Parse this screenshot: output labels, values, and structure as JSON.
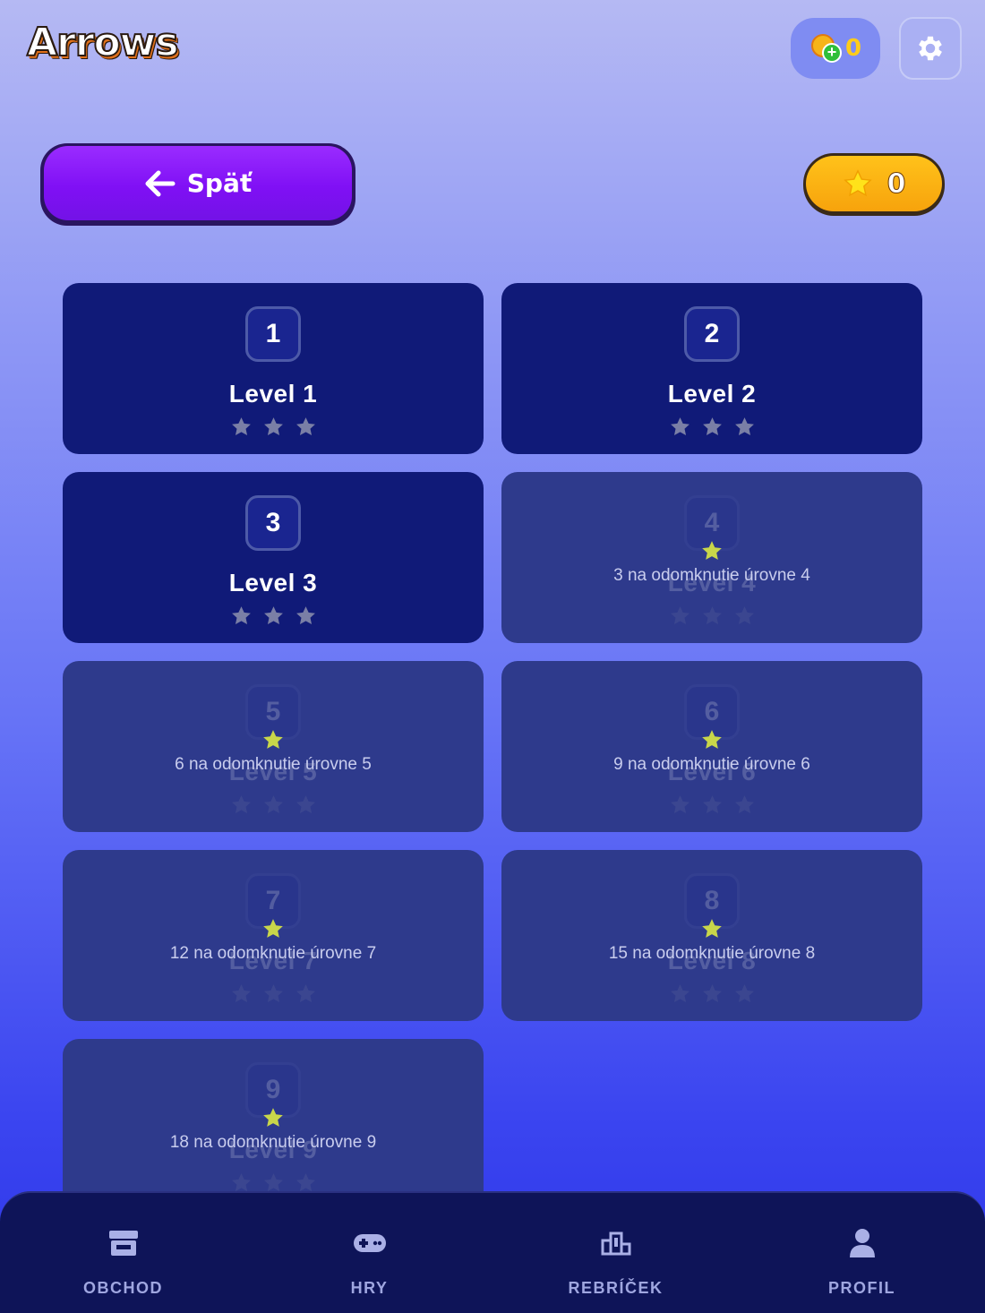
{
  "header": {
    "app_title": "Arrows",
    "coins": "0",
    "settings_icon": "gear-icon"
  },
  "toolbar": {
    "back_label": "Späť",
    "stars_total": "0"
  },
  "levels": [
    {
      "number": "1",
      "name": "Level 1",
      "stars": 0,
      "locked": false,
      "lock_text": ""
    },
    {
      "number": "2",
      "name": "Level 2",
      "stars": 0,
      "locked": false,
      "lock_text": ""
    },
    {
      "number": "3",
      "name": "Level 3",
      "stars": 0,
      "locked": false,
      "lock_text": ""
    },
    {
      "number": "4",
      "name": "Level 4",
      "stars": 0,
      "locked": true,
      "lock_text": "3 na odomknutie úrovne 4"
    },
    {
      "number": "5",
      "name": "Level 5",
      "stars": 0,
      "locked": true,
      "lock_text": "6 na odomknutie úrovne 5"
    },
    {
      "number": "6",
      "name": "Level 6",
      "stars": 0,
      "locked": true,
      "lock_text": "9 na odomknutie úrovne 6"
    },
    {
      "number": "7",
      "name": "Level 7",
      "stars": 0,
      "locked": true,
      "lock_text": "12 na odomknutie úrovne 7"
    },
    {
      "number": "8",
      "name": "Level 8",
      "stars": 0,
      "locked": true,
      "lock_text": "15 na odomknutie úrovne 8"
    },
    {
      "number": "9",
      "name": "Level 9",
      "stars": 0,
      "locked": true,
      "lock_text": "18 na odomknutie úrovne 9"
    }
  ],
  "nav": {
    "shop": "OBCHOD",
    "games": "HRY",
    "leaderboard": "REBRÍČEK",
    "profile": "PROFIL"
  },
  "colors": {
    "accent_purple": "#8010f5",
    "accent_gold": "#ffc21a",
    "card_unlocked": "#101a78",
    "card_locked": "#2e3a8c",
    "star_earned_locked": "#c8d64a"
  }
}
